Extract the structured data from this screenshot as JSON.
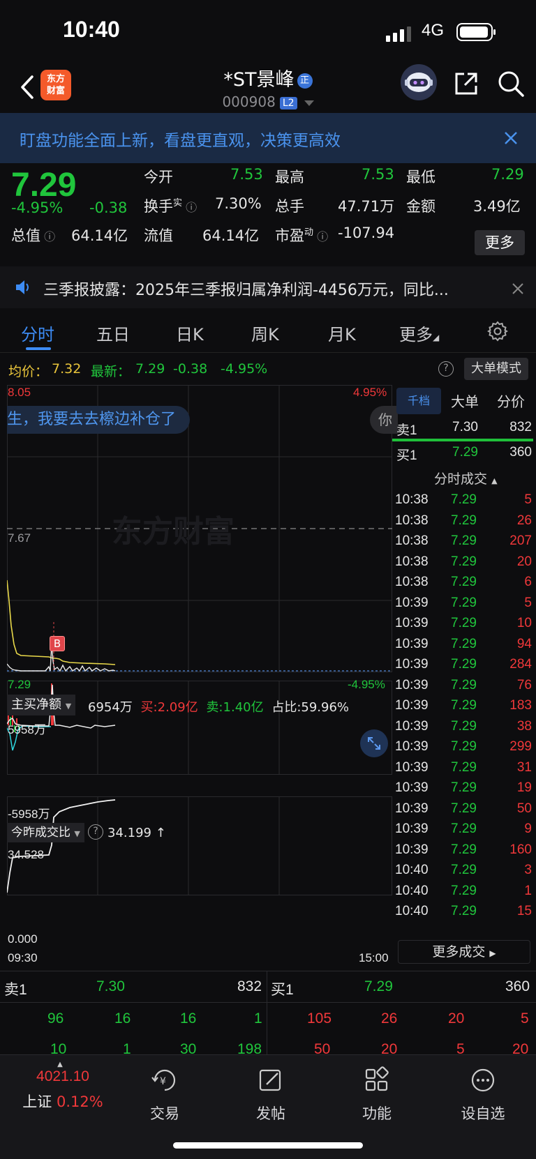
{
  "status_bar": {
    "time": "10:40",
    "network": "4G"
  },
  "header": {
    "logo_line1": "东方",
    "logo_line2": "财富",
    "stock_name": "*ST景峰",
    "name_badge": "正",
    "stock_code": "000908",
    "level_badge": "L2"
  },
  "promo": {
    "text": "盯盘功能全面上新，看盘更直观，决策更高效"
  },
  "quote": {
    "price": "7.29",
    "change_pct": "-4.95%",
    "change": "-0.38",
    "open_label": "今开",
    "open": "7.53",
    "high_label": "最高",
    "high": "7.53",
    "low_label": "最低",
    "low": "7.29",
    "turnover_label": "换手",
    "turnover_sup": "实",
    "turnover": "7.30%",
    "volume_label": "总手",
    "volume": "47.71万",
    "amount_label": "金额",
    "amount": "3.49亿",
    "mktcap_label": "总值",
    "mktcap": "64.14亿",
    "float_label": "流值",
    "float": "64.14亿",
    "pe_label": "市盈",
    "pe_sup": "动",
    "pe": "-107.94",
    "more_button": "更多"
  },
  "notice": {
    "text": "三季报披露：2025年三季报归属净利润-4456万元，同比..."
  },
  "tabs": [
    "分时",
    "五日",
    "日K",
    "周K",
    "月K",
    "更多"
  ],
  "avg_row": {
    "avg_label": "均价：",
    "avg": "7.32",
    "last_label": "最新：",
    "last": "7.29",
    "chg": "-0.38",
    "pct": "-4.95%",
    "mode_button": "大单模式"
  },
  "chart": {
    "y_top": "8.05",
    "y_mid": "7.67",
    "y_bottom": "7.29",
    "pct_top": "4.95%",
    "pct_bottom": "-4.95%",
    "time_start": "09:30",
    "time_end": "15:00",
    "danmu_1": "生，我要去去檫边补仓了",
    "danmu_2": "你",
    "marker": "B",
    "watermark": "东方财富"
  },
  "netbuy": {
    "label": "主买净额",
    "value": "6954万",
    "buy_label": "买:",
    "buy": "2.09亿",
    "sell_label": "卖:",
    "sell": "1.40亿",
    "ratio_label": "占比:",
    "ratio": "59.96%",
    "y_top": "5958万",
    "y_bottom": "-5958万"
  },
  "vol_ratio": {
    "label": "今昨成交比",
    "value": "34.199 ↑",
    "y_top": "34.528",
    "y_bottom": "0.000"
  },
  "orderbook": {
    "tabs": [
      "千档",
      "大单",
      "分价"
    ],
    "ask1": {
      "label": "卖1",
      "price": "7.30",
      "vol": "832"
    },
    "bid1": {
      "label": "买1",
      "price": "7.29",
      "vol": "360"
    },
    "trades_title": "分时成交",
    "trades": [
      {
        "t": "10:38",
        "p": "7.29",
        "v": "5"
      },
      {
        "t": "10:38",
        "p": "7.29",
        "v": "26"
      },
      {
        "t": "10:38",
        "p": "7.29",
        "v": "207"
      },
      {
        "t": "10:38",
        "p": "7.29",
        "v": "20"
      },
      {
        "t": "10:38",
        "p": "7.29",
        "v": "6"
      },
      {
        "t": "10:39",
        "p": "7.29",
        "v": "5"
      },
      {
        "t": "10:39",
        "p": "7.29",
        "v": "10"
      },
      {
        "t": "10:39",
        "p": "7.29",
        "v": "94"
      },
      {
        "t": "10:39",
        "p": "7.29",
        "v": "284"
      },
      {
        "t": "10:39",
        "p": "7.29",
        "v": "76"
      },
      {
        "t": "10:39",
        "p": "7.29",
        "v": "183"
      },
      {
        "t": "10:39",
        "p": "7.29",
        "v": "38"
      },
      {
        "t": "10:39",
        "p": "7.29",
        "v": "299"
      },
      {
        "t": "10:39",
        "p": "7.29",
        "v": "31"
      },
      {
        "t": "10:39",
        "p": "7.29",
        "v": "19"
      },
      {
        "t": "10:39",
        "p": "7.29",
        "v": "50"
      },
      {
        "t": "10:39",
        "p": "7.29",
        "v": "9"
      },
      {
        "t": "10:39",
        "p": "7.29",
        "v": "160"
      },
      {
        "t": "10:40",
        "p": "7.29",
        "v": "3"
      },
      {
        "t": "10:40",
        "p": "7.29",
        "v": "1"
      },
      {
        "t": "10:40",
        "p": "7.29",
        "v": "15"
      }
    ],
    "more_trades": "更多成交"
  },
  "level_book": {
    "ask_label": "卖1",
    "ask_price": "7.30",
    "ask_vol": "832",
    "bid_label": "买1",
    "bid_price": "7.29",
    "bid_vol": "360",
    "ask_row1": [
      "96",
      "16",
      "16",
      "1"
    ],
    "ask_row2": [
      "10",
      "1",
      "30",
      "198"
    ],
    "bid_row1": [
      "105",
      "26",
      "20",
      "5"
    ],
    "bid_row2": [
      "50",
      "20",
      "5",
      "20"
    ]
  },
  "bottom_nav": {
    "index_value": "4021.10",
    "index_name": "上证",
    "index_pct": "0.12%",
    "trade": "交易",
    "post": "发帖",
    "func": "功能",
    "watch": "设自选"
  },
  "colors": {
    "up": "#f0383a",
    "down": "#20c53c",
    "accent": "#3d8cf5",
    "avg_line": "#e9d94a"
  }
}
